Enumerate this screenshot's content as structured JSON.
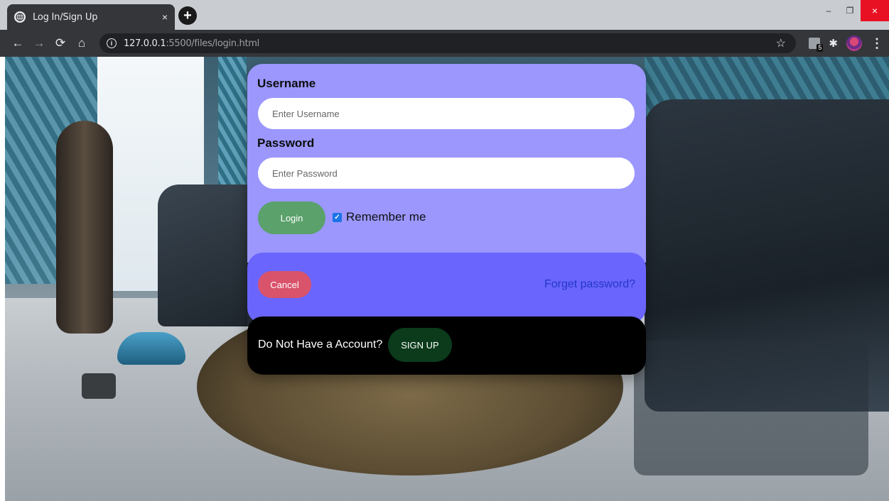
{
  "browser": {
    "tab_title": "Log In/Sign Up",
    "tab_close": "×",
    "new_tab": "+",
    "url_host": "127.0.0.1",
    "url_rest": ":5500/files/login.html",
    "extension_badge_count": "5",
    "window_minimize": "–",
    "window_restore": "❐",
    "window_close": "×"
  },
  "form": {
    "username_label": "Username",
    "username_placeholder": "Enter Username",
    "password_label": "Password",
    "password_placeholder": "Enter Password",
    "login_label": "Login",
    "remember_label": "Remember me",
    "remember_checked": true,
    "cancel_label": "Cancel",
    "forget_label": "Forget password?",
    "no_account_text": "Do Not Have a Account?",
    "signup_label": "SIGN UP"
  },
  "colors": {
    "card_top": "#9b97fd",
    "card_mid": "#6a65fc",
    "card_bottom": "#000000",
    "login_button": "#5aa16b",
    "cancel_button": "#d9536b",
    "signup_button": "#0b3b1b",
    "forget_link": "#2437c9"
  },
  "icons": {
    "favicon": "globe-icon",
    "back": "arrow-left-icon",
    "forward": "arrow-right-icon",
    "reload": "reload-icon",
    "home": "home-icon",
    "site_info": "info-icon",
    "bookmark": "star-icon",
    "extensions": "puzzle-icon",
    "menu": "kebab-menu-icon"
  }
}
